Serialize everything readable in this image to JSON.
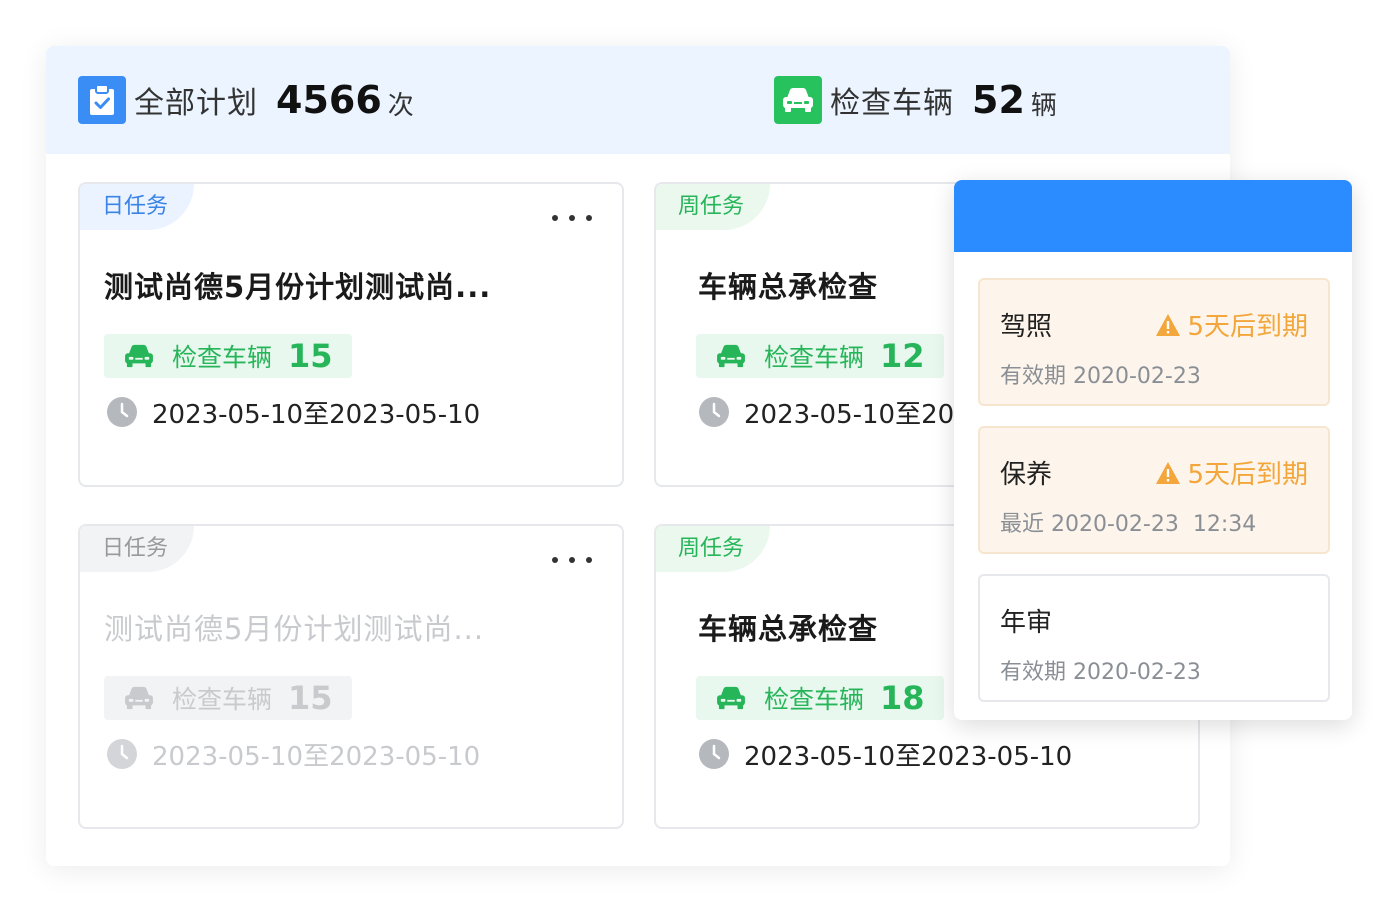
{
  "colors": {
    "summary_bg": "#ebf4ff",
    "blue_accent": "#3a8df5",
    "green_accent": "#27b55a",
    "popover_header": "#2a8cff",
    "warning": "#f2a63b",
    "disabled_text": "#c8cacd"
  },
  "summary": {
    "plans": {
      "icon": "clipboard-check-icon",
      "label": "全部计划",
      "value": "4566",
      "unit": "次"
    },
    "vehicles": {
      "icon": "car-icon",
      "label": "检查车辆",
      "value": "52",
      "unit": "辆"
    }
  },
  "cards": [
    {
      "tag": "日任务",
      "title": "测试尚德5月份计划测试尚...",
      "vehicle_label": "检查车辆",
      "vehicle_count": "15",
      "date": "2023-05-10至2023-05-10"
    },
    {
      "tag": "周任务",
      "title": "车辆总承检查",
      "vehicle_label": "检查车辆",
      "vehicle_count": "12",
      "date": "2023-05-10至20"
    },
    {
      "tag": "日任务",
      "title": "测试尚德5月份计划测试尚...",
      "vehicle_label": "检查车辆",
      "vehicle_count": "15",
      "date": "2023-05-10至2023-05-10",
      "disabled": true
    },
    {
      "tag": "周任务",
      "title": "车辆总承检查",
      "vehicle_label": "检查车辆",
      "vehicle_count": "18",
      "date": "2023-05-10至2023-05-10"
    }
  ],
  "popover": {
    "items": [
      {
        "name": "驾照",
        "warning": "5天后到期",
        "sub": "有效期 2020-02-23"
      },
      {
        "name": "保养",
        "warning": "5天后到期",
        "sub": "最近 2020-02-23  12:34"
      },
      {
        "name": "年审",
        "sub": "有效期 2020-02-23"
      }
    ]
  }
}
